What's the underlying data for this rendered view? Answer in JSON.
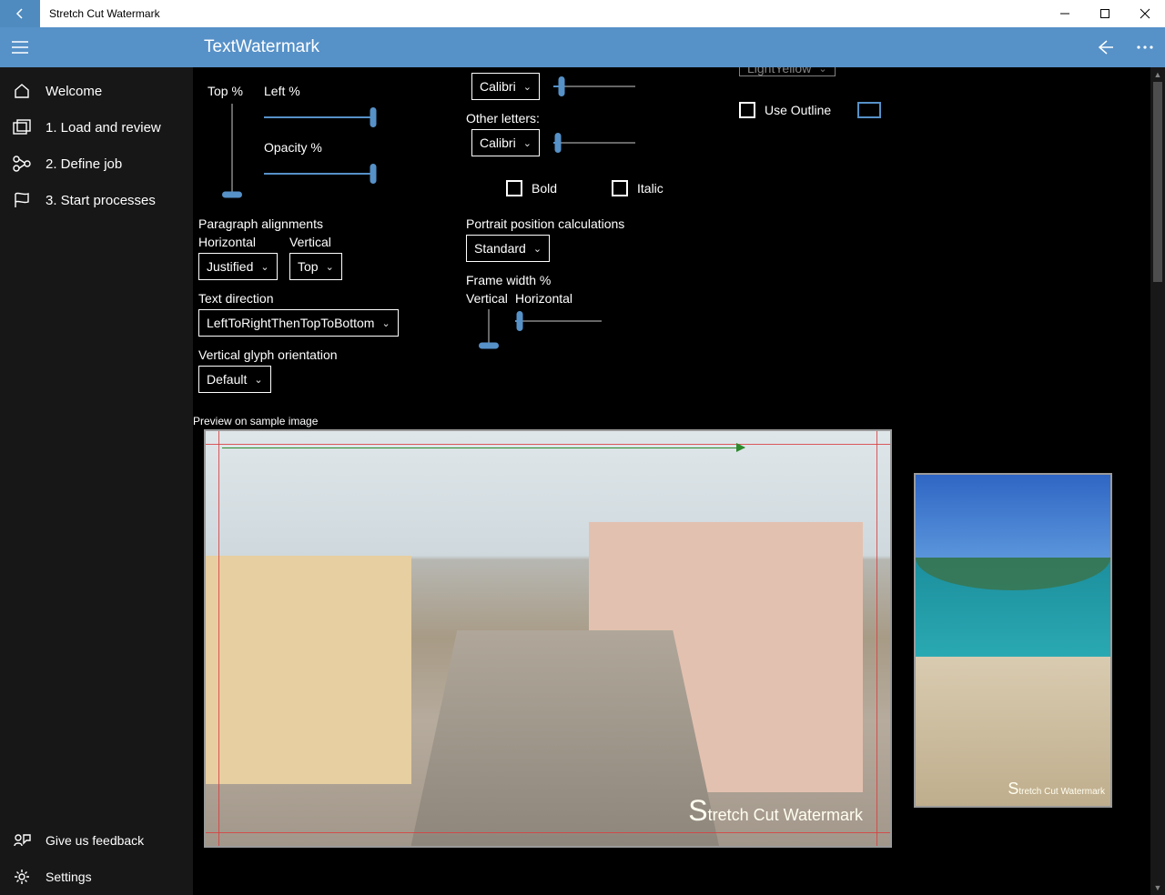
{
  "titlebar": {
    "title": "Stretch Cut Watermark"
  },
  "cmdbar": {
    "title": "TextWatermark"
  },
  "sidebar": {
    "items": [
      {
        "label": "Welcome"
      },
      {
        "label": "1. Load and review"
      },
      {
        "label": "2. Define job"
      },
      {
        "label": "3. Start processes"
      }
    ],
    "feedback": "Give us feedback",
    "settings": "Settings"
  },
  "panel": {
    "top_pct": "Top %",
    "left_pct": "Left %",
    "opacity_pct": "Opacity %",
    "paragraph_alignments": "Paragraph alignments",
    "horizontal": "Horizontal",
    "vertical": "Vertical",
    "justified": "Justified",
    "top": "Top",
    "text_direction": "Text direction",
    "text_direction_value": "LeftToRightThenTopToBottom",
    "vertical_glyph": "Vertical glyph orientation",
    "vertical_glyph_value": "Default",
    "other_letters": "Other letters:",
    "font_value": "Calibri",
    "bold": "Bold",
    "italic": "Italic",
    "portrait_calc": "Portrait position calculations",
    "portrait_value": "Standard",
    "frame_width": "Frame width %",
    "fw_vertical": "Vertical",
    "fw_horizontal": "Horizontal",
    "color_value": "LightYellow",
    "use_outline": "Use Outline",
    "preview_label": "Preview on sample image",
    "watermark_text": "tretch Cut Watermark",
    "watermark_first": "S"
  }
}
